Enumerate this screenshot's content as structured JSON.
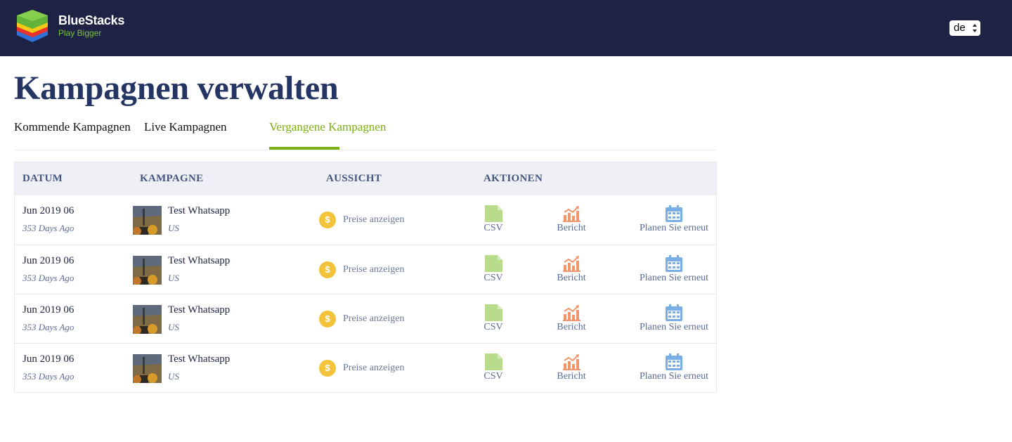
{
  "header": {
    "brand_name": "BlueStacks",
    "brand_tagline": "Play Bigger",
    "language": "de",
    "colors": {
      "background": "#1e2245",
      "tagline": "#7dc142"
    }
  },
  "page": {
    "title": "Kampagnen verwalten",
    "tabs": [
      {
        "label": "Kommende Kampagnen",
        "active": false
      },
      {
        "label": "Live Kampagnen",
        "active": false
      },
      {
        "label": "Vergangene Kampagnen",
        "active": true
      }
    ],
    "accent_color": "#7bae10"
  },
  "table": {
    "headers": {
      "date": "DATUM",
      "campaign": "KAMPAGNE",
      "view": "AUSSICHT",
      "actions": "AKTIONEN"
    },
    "rows": [
      {
        "date": "Jun 2019 06",
        "ago": "353 Days Ago",
        "name": "Test Whatsapp",
        "country": "US",
        "price_link": "Preise anzeigen",
        "coin": "$",
        "csv": "CSV",
        "report": "Bericht",
        "reschedule": "Planen Sie erneut"
      },
      {
        "date": "Jun 2019 06",
        "ago": "353 Days Ago",
        "name": "Test Whatsapp",
        "country": "US",
        "price_link": "Preise anzeigen",
        "coin": "$",
        "csv": "CSV",
        "report": "Bericht",
        "reschedule": "Planen Sie erneut"
      },
      {
        "date": "Jun 2019 06",
        "ago": "353 Days Ago",
        "name": "Test Whatsapp",
        "country": "US",
        "price_link": "Preise anzeigen",
        "coin": "$",
        "csv": "CSV",
        "report": "Bericht",
        "reschedule": "Planen Sie erneut"
      },
      {
        "date": "Jun 2019 06",
        "ago": "353 Days Ago",
        "name": "Test Whatsapp",
        "country": "US",
        "price_link": "Preise anzeigen",
        "coin": "$",
        "csv": "CSV",
        "report": "Bericht",
        "reschedule": "Planen Sie erneut"
      }
    ],
    "icons": {
      "csv": "file-icon",
      "report": "bar-chart-icon",
      "reschedule": "calendar-icon",
      "price": "dollar-coin-icon"
    },
    "icon_colors": {
      "csv": "#b9dc8c",
      "report": "#f3956a",
      "reschedule": "#7aaee6",
      "coin": "#f2c33b"
    }
  }
}
